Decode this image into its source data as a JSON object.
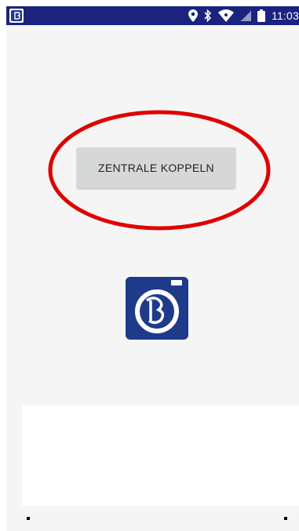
{
  "status_bar": {
    "time": "11:03",
    "background": "#1a237e",
    "icons": [
      "app-notification-icon",
      "location-icon",
      "bluetooth-icon",
      "wifi-icon",
      "signal-icon",
      "battery-icon"
    ]
  },
  "main": {
    "pair_button_label": "ZENTRALE KOPPELN",
    "highlight_color": "#e00000",
    "logo_color": "#1e3a8a"
  },
  "colors": {
    "background": "#f5f5f5",
    "button": "#d6d7d7"
  }
}
